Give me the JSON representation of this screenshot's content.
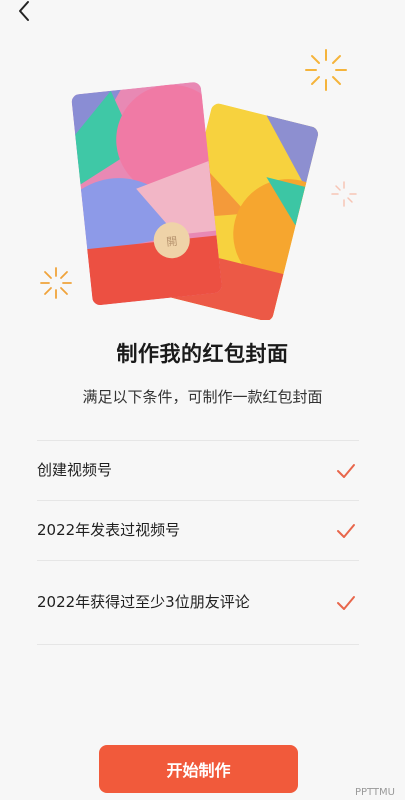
{
  "nav": {
    "back_icon": "chevron-left-icon"
  },
  "page": {
    "title": "制作我的红包封面",
    "subtitle": "满足以下条件，可制作一款红包封面"
  },
  "conditions": [
    {
      "label": "创建视频号",
      "status_icon": "checkmark-icon"
    },
    {
      "label": "2022年发表过视频号",
      "status_icon": "checkmark-icon"
    },
    {
      "label": "2022年获得过至少3位朋友评论",
      "status_icon": "checkmark-icon"
    }
  ],
  "actions": {
    "start_label": "开始制作"
  },
  "watermark": {
    "text": "PPTTMU"
  },
  "colors": {
    "accent": "#f15a3b",
    "check": "#e8664b",
    "background": "#f7f7f7"
  }
}
